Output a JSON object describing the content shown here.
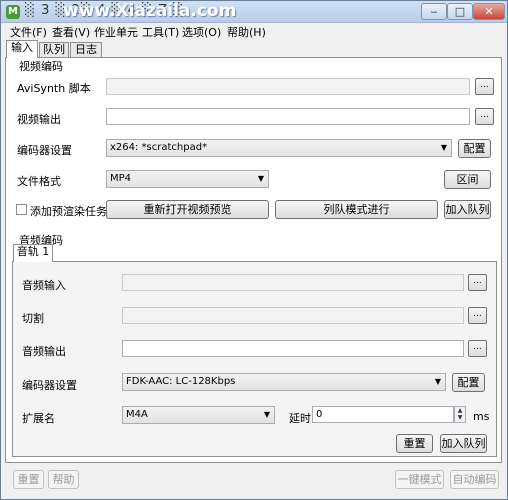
{
  "window": {
    "title": "░ 3 ░ 2░ 4 ░ 4 ░ Z ░",
    "watermark": "www.Xiazaila.com",
    "controls": {
      "minimize": "‒",
      "maximize": "□",
      "close": "✕"
    }
  },
  "menu": [
    "文件(F)",
    "查看(V)",
    "作业单元",
    "工具(T)",
    "选项(O)",
    "帮助(H)"
  ],
  "tabs": [
    "输入",
    "队列",
    "日志"
  ],
  "video": {
    "section_title": "视频编码",
    "avisynth_label": "AviSynth 脚本",
    "avisynth_value": "",
    "output_label": "视频输出",
    "output_value": "",
    "encoder_label": "编码器设置",
    "encoder_value": "x264: *scratchpad*",
    "config_button": "配置",
    "format_label": "文件格式",
    "format_value": "MP4",
    "section_button": "区间",
    "prerender_label": "添加预渲染任务",
    "reopen_preview_button": "重新打开视频预览",
    "queue_mode_button": "列队模式进行",
    "add_queue_button": "加入队列",
    "browse": "..."
  },
  "audio": {
    "section_title": "音频编码",
    "track_tab": "音轨 1",
    "input_label": "音频输入",
    "input_value": "",
    "cut_label": "切割",
    "cut_value": "",
    "output_label": "音频输出",
    "output_value": "",
    "encoder_label": "编码器设置",
    "encoder_value": "FDK-AAC: LC-128Kbps",
    "config_button": "配置",
    "ext_label": "扩展名",
    "ext_value": "M4A",
    "delay_label": "延时",
    "delay_value": "0",
    "delay_unit": "ms",
    "reset_button": "重置",
    "add_queue_button": "加入队列",
    "browse": "..."
  },
  "footer": {
    "reset_button": "重置",
    "help_button": "帮助",
    "one_click_button": "一键模式",
    "auto_encode_button": "自动编码"
  }
}
